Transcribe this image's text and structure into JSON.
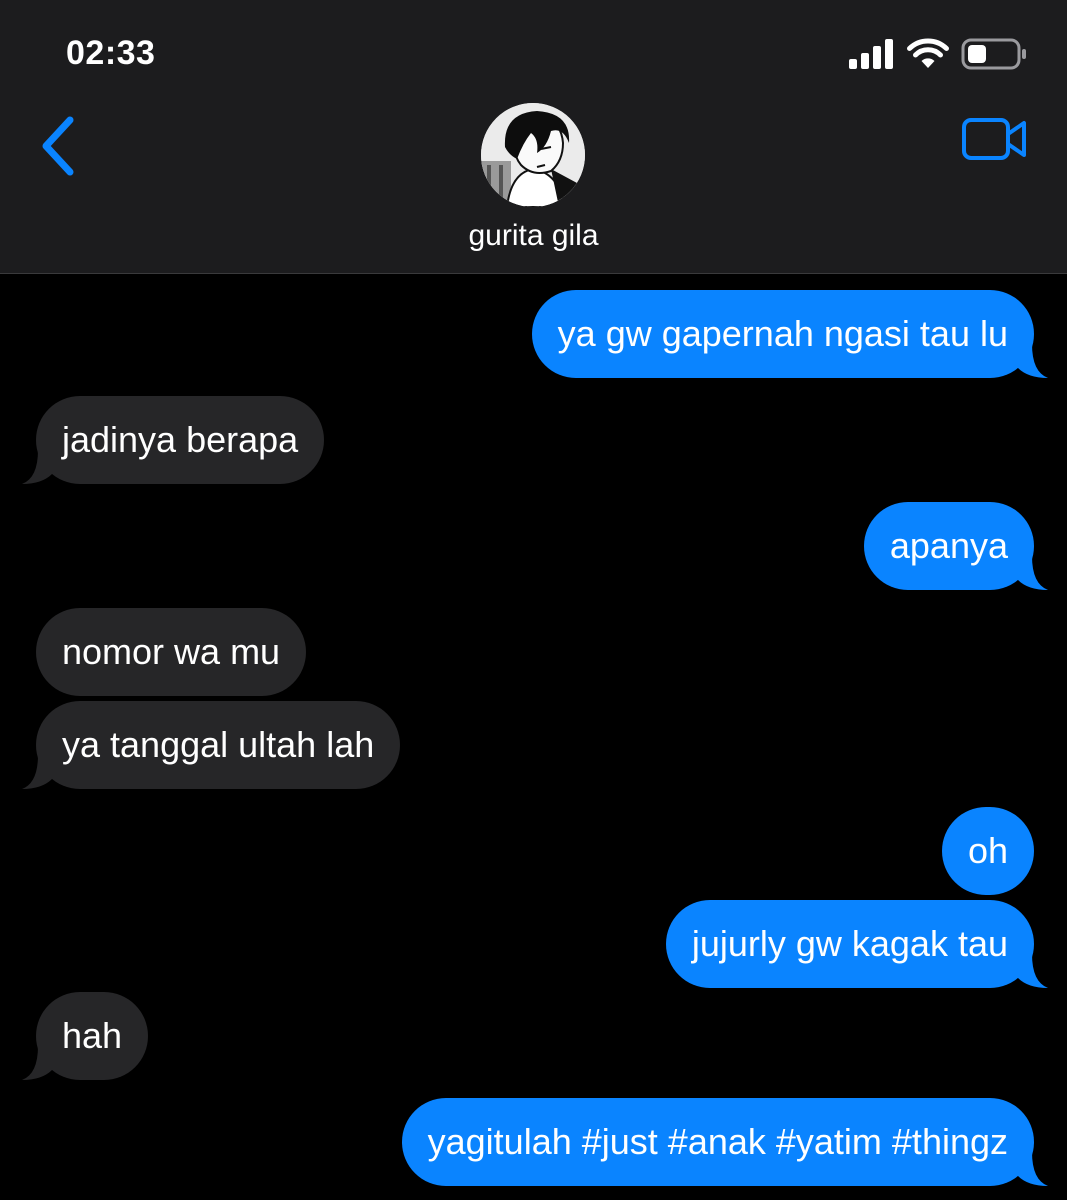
{
  "status_bar": {
    "time": "02:33",
    "icons": [
      "signal-icon",
      "wifi-icon",
      "battery-icon"
    ],
    "battery_level": 0.4
  },
  "header": {
    "contact_name": "gurita gila",
    "back_icon": "chevron-left-icon",
    "video_icon": "video-camera-icon"
  },
  "colors": {
    "accent": "#0a84ff",
    "sent_bubble": "#0a84ff",
    "received_bubble": "#262628",
    "header_bg": "#1c1c1e",
    "background": "#000000"
  },
  "messages": [
    {
      "direction": "sent",
      "text": "ya gw gapernah ngasi tau lu",
      "tail": true
    },
    {
      "direction": "received",
      "text": "jadinya berapa",
      "tail": true
    },
    {
      "direction": "sent",
      "text": "apanya",
      "tail": true
    },
    {
      "direction": "received",
      "text": "nomor wa mu",
      "tail": false
    },
    {
      "direction": "received",
      "text": "ya tanggal ultah lah",
      "tail": true
    },
    {
      "direction": "sent",
      "text": "oh",
      "tail": false
    },
    {
      "direction": "sent",
      "text": "jujurly gw kagak tau",
      "tail": true
    },
    {
      "direction": "received",
      "text": "hah",
      "tail": true
    },
    {
      "direction": "sent",
      "text": "yagitulah #just #anak #yatim #thingz",
      "tail": true
    }
  ]
}
